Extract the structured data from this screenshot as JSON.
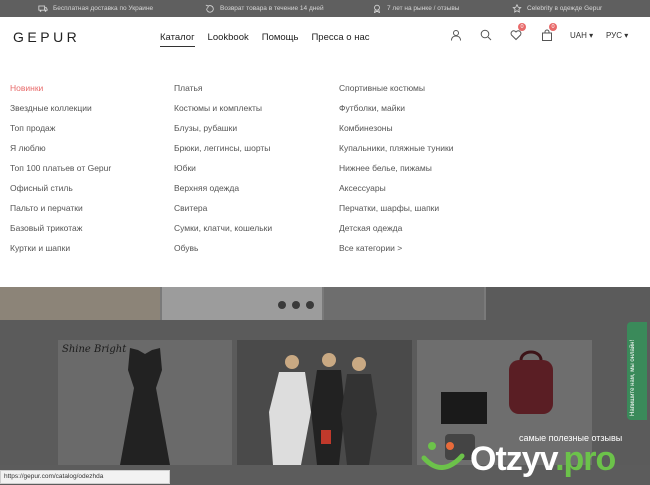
{
  "promo": [
    {
      "icon": "car-icon",
      "text": "Бесплатная доставка по Украине"
    },
    {
      "icon": "return-icon",
      "text": "Возврат товара в течение 14 дней"
    },
    {
      "icon": "award-icon",
      "text": "7 лет на рынке / отзывы"
    },
    {
      "icon": "star-icon",
      "text": "Celebrity в одежде Gepur"
    }
  ],
  "header": {
    "logo": "GEPUR",
    "nav": [
      "Каталог",
      "Lookbook",
      "Помощь",
      "Пресса о нас"
    ],
    "wishlist_count": "0",
    "cart_count": "0",
    "currency": "UAH",
    "language": "РУС"
  },
  "menu": {
    "col1": [
      "Новинки",
      "Звездные коллекции",
      "Топ продаж",
      "Я люблю",
      "Топ 100 платьев от Gepur",
      "Офисный стиль",
      "Пальто и перчатки",
      "Базовый трикотаж",
      "Куртки и шапки"
    ],
    "col2": [
      "Платья",
      "Костюмы и комплекты",
      "Блузы, рубашки",
      "Брюки, леггинсы, шорты",
      "Юбки",
      "Верхняя одежда",
      "Свитера",
      "Сумки, клатчи, кошельки",
      "Обувь"
    ],
    "col3": [
      "Спортивные костюмы",
      "Футболки, майки",
      "Комбинезоны",
      "Купальники, пляжные туники",
      "Нижнее белье, пижамы",
      "Аксессуары",
      "Перчатки, шарфы, шапки",
      "Детская одежда",
      "Все категории >"
    ]
  },
  "tiles": {
    "shine_text": "Shine Bright"
  },
  "sidetab": "Напишите нам, мы онлайн!",
  "statusbar": "https://gepur.com/catalog/odezhda",
  "watermark": {
    "tagline": "самые полезные отзывы",
    "brand_prefix": "Otzyv",
    "brand_suffix": ".pro"
  },
  "colors": {
    "accent": "#e86a6a",
    "chat": "#3a8a5a",
    "watermark_green": "#6cc24a"
  }
}
